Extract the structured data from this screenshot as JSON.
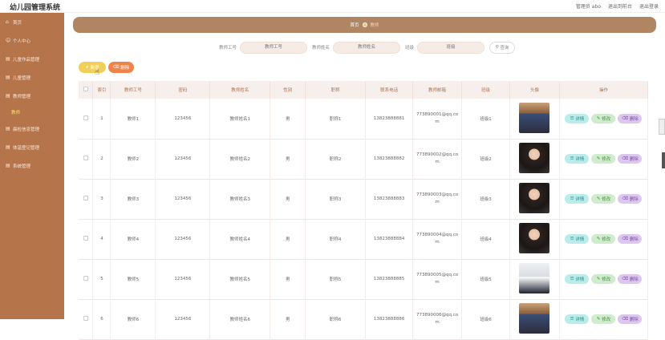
{
  "app": {
    "title": "幼儿园管理系统"
  },
  "topbar": {
    "user_label": "管理员 abo",
    "back_label": "退出到前台",
    "logout_label": "退出登录"
  },
  "sidebar": {
    "items": [
      {
        "icon": "home-icon",
        "label": "首页"
      },
      {
        "icon": "user-icon",
        "label": "个人中心"
      },
      {
        "icon": "works-icon",
        "label": "儿童作品管理"
      },
      {
        "icon": "child-icon",
        "label": "儿童管理"
      },
      {
        "icon": "teacher-icon",
        "label": "教师管理"
      },
      {
        "icon": "health-icon",
        "label": "晨检信息管理"
      },
      {
        "icon": "temp-icon",
        "label": "体温登记管理"
      },
      {
        "icon": "system-icon",
        "label": "系统管理"
      }
    ],
    "active_sub": "教师"
  },
  "breadcrumb": {
    "home": "首页",
    "current": "教师"
  },
  "search": {
    "fields": [
      {
        "label": "教师工号",
        "placeholder": "教师工号"
      },
      {
        "label": "教师姓名",
        "placeholder": "教师姓名"
      },
      {
        "label": "班级",
        "placeholder": "班级"
      }
    ],
    "query_label": "查询"
  },
  "toolbar": {
    "add_label": "新增",
    "delete_label": "删除"
  },
  "table": {
    "headers": [
      "索引",
      "教师工号",
      "密码",
      "教师姓名",
      "性别",
      "职称",
      "联系电话",
      "教师邮箱",
      "班级",
      "头像",
      "操作"
    ],
    "ops": {
      "detail": "详情",
      "edit": "修改",
      "delete": "删除"
    },
    "rows": [
      {
        "idx": "1",
        "no": "教师1",
        "pwd": "123456",
        "name": "教师姓名1",
        "sex": "男",
        "title": "职称1",
        "phone": "13823888881",
        "email1": "773890001@qq.co",
        "email2": "m",
        "cls": "班级1",
        "photo": "ph-a"
      },
      {
        "idx": "2",
        "no": "教师2",
        "pwd": "123456",
        "name": "教师姓名2",
        "sex": "男",
        "title": "职称2",
        "phone": "13823888882",
        "email1": "773890002@qq.co",
        "email2": "m",
        "cls": "班级2",
        "photo": "ph-b"
      },
      {
        "idx": "3",
        "no": "教师3",
        "pwd": "123456",
        "name": "教师姓名3",
        "sex": "男",
        "title": "职称3",
        "phone": "13823888883",
        "email1": "773890003@qq.co",
        "email2": "m",
        "cls": "班级3",
        "photo": "ph-b"
      },
      {
        "idx": "4",
        "no": "教师4",
        "pwd": "123456",
        "name": "教师姓名4",
        "sex": "男",
        "title": "职称4",
        "phone": "13823888884",
        "email1": "773890004@qq.co",
        "email2": "m",
        "cls": "班级4",
        "photo": "ph-b"
      },
      {
        "idx": "5",
        "no": "教师5",
        "pwd": "123456",
        "name": "教师姓名5",
        "sex": "男",
        "title": "职称5",
        "phone": "13823888885",
        "email1": "773890005@qq.co",
        "email2": "m",
        "cls": "班级5",
        "photo": "ph-c"
      },
      {
        "idx": "6",
        "no": "教师6",
        "pwd": "123456",
        "name": "教师姓名6",
        "sex": "男",
        "title": "职称6",
        "phone": "13823888886",
        "email1": "773890006@qq.co",
        "email2": "m",
        "cls": "班级6",
        "photo": "ph-a"
      }
    ]
  }
}
